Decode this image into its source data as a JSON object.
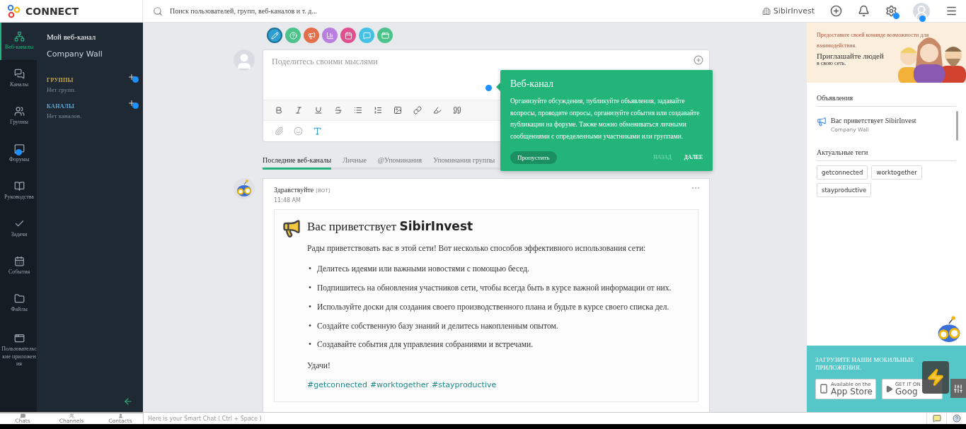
{
  "brand": {
    "name": "CONNECT"
  },
  "search": {
    "placeholder": "Поиск пользователей, групп, веб-каналов и т. д..."
  },
  "topbar": {
    "company": "SibirInvest",
    "settings_dot": true,
    "avatar_dot": true
  },
  "rail": [
    {
      "label": "Веб-каналы",
      "selected": true,
      "dot": false
    },
    {
      "label": "Каналы",
      "selected": false,
      "dot": false
    },
    {
      "label": "Группы",
      "selected": false,
      "dot": false
    },
    {
      "label": "Форумы",
      "selected": false,
      "dot": true
    },
    {
      "label": "Руководства",
      "selected": false,
      "dot": false
    },
    {
      "label": "Задачи",
      "selected": false,
      "dot": false
    },
    {
      "label": "События",
      "selected": false,
      "dot": false
    },
    {
      "label": "Файлы",
      "selected": false,
      "dot": false
    },
    {
      "label": "Пользовательские приложения",
      "selected": false,
      "dot": false
    }
  ],
  "subnav": {
    "items": [
      {
        "label": "Мой веб-канал",
        "selected": true
      },
      {
        "label": "Company Wall",
        "selected": false
      }
    ],
    "sections": [
      {
        "title": "ГРУППЫ",
        "empty": "Нет групп.",
        "color": "#c9a64a"
      },
      {
        "title": "КАНАЛЫ",
        "empty": "Нет каналов.",
        "color": "#5aa9d6"
      }
    ]
  },
  "composer": {
    "post_types": [
      {
        "color": "#2e9fd0",
        "selected": true
      },
      {
        "color": "#4cc38a",
        "selected": false
      },
      {
        "color": "#e4704a",
        "selected": false
      },
      {
        "color": "#b97fe0",
        "selected": false
      },
      {
        "color": "#e0508f",
        "selected": false
      },
      {
        "color": "#45c1e6",
        "selected": false
      },
      {
        "color": "#4cc38a",
        "selected": false
      }
    ],
    "placeholder": "Поделитесь своими мыслями"
  },
  "feed_tabs": [
    {
      "label": "Последние веб-каналы",
      "selected": true
    },
    {
      "label": "Личные",
      "selected": false
    },
    {
      "label": "@Упоминания",
      "selected": false
    },
    {
      "label": "Упоминания группы",
      "selected": false
    }
  ],
  "tooltip": {
    "title": "Веб-канал",
    "body": "Организуйте обсуждения, публикуйте объявления, задавайте вопросы, проводите опросы, организуйте события или создавайте публикации на форуме. Также можно обмениваться личными сообщениями с определенными участниками или группами.",
    "skip": "Пропустить",
    "back": {
      "label": "НАЗАД",
      "disabled": true
    },
    "next": {
      "label": "ДАЛЕЕ",
      "disabled": false
    }
  },
  "post": {
    "author": "Здравствуйте",
    "tag": "[BOT]",
    "time": "11:48 AM",
    "title": "Вас приветствует **SibirInvest**",
    "intro": "Рады приветствовать вас в этой сети! Вот несколько способов эффективного использования сети:",
    "bullets": [
      "Делитесь идеями или важными новостями с помощью бесед.",
      "Подпишитесь на обновления участников сети, чтобы всегда быть в курсе важной информации от них.",
      "Используйте доски для создания своего производственного плана и будьте в курсе своего списка дел.",
      "Создайте собственную базу знаний и делитесь накопленным опытом.",
      "Создавайте события для управления собраниями и встречами."
    ],
    "bullet_marker": "•",
    "closing": "Удачи!",
    "hashtags": [
      "#getconnected",
      "#worktogether",
      "#stayproductive"
    ]
  },
  "right": {
    "banner": {
      "text": "Предоставьте своей команде возможности для взаимодействия.",
      "headline": "Приглашайте людей",
      "subline": "в свою сеть."
    },
    "announcements": {
      "title": "Объявления",
      "items": [
        {
          "title": "Вас приветствует SibirInvest",
          "source": "Company Wall"
        }
      ]
    },
    "tags": {
      "title": "Актуальные теги",
      "items": [
        "getconnected",
        "worktogether",
        "stayproductive"
      ]
    },
    "apps": {
      "title": "ЗАГРУЗИТЕ НАШИ МОБИЛЬНЫЕ ПРИЛОЖЕНИЯ.",
      "badges": [
        {
          "kind": "apple",
          "small": "Available on the",
          "big": "App Store"
        },
        {
          "kind": "google",
          "small": "GET IT ON",
          "big": "Goog"
        }
      ]
    }
  },
  "bottom": {
    "tabs": [
      "Chats",
      "Channels",
      "Contacts"
    ],
    "chat_placeholder": "Here is your Smart Chat ( Ctrl + Space )"
  }
}
